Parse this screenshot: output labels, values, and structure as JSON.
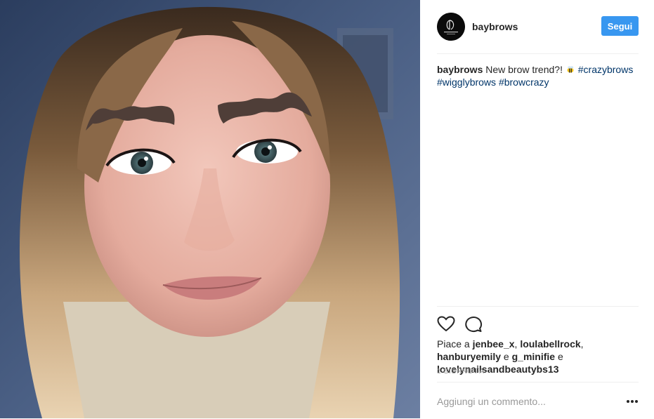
{
  "post": {
    "photo_alt": "",
    "header": {
      "username": "baybrows",
      "follow_label": "Segui",
      "avatar_icon": "brand-logo-avatar"
    },
    "caption": {
      "username": "baybrows",
      "text": "New brow trend?!",
      "emoji_icon": "bee-emoji-icon",
      "tag1": "#crazybrows",
      "tag2": "#wigglybrows",
      "tag3": "#browcrazy"
    },
    "actions": {
      "like_icon": "heart-icon",
      "comment_icon": "comment-icon"
    },
    "likes": {
      "prefix": "Piace a",
      "user1": "jenbee_x",
      "user2": "loulabellrock",
      "user3": "hanburyemily",
      "conj1": "e",
      "user4": "g_minifie",
      "conj2": "e",
      "user5": "lovelynailsandbeautybs13"
    },
    "timestamp": "1 giorno fa",
    "comment": {
      "placeholder": "Aggiungi un commento...",
      "more_icon": "more-options-icon"
    },
    "colors": {
      "accent": "#3897f0",
      "hashtag": "#003569",
      "divider": "#efefef",
      "muted": "#999999"
    }
  }
}
